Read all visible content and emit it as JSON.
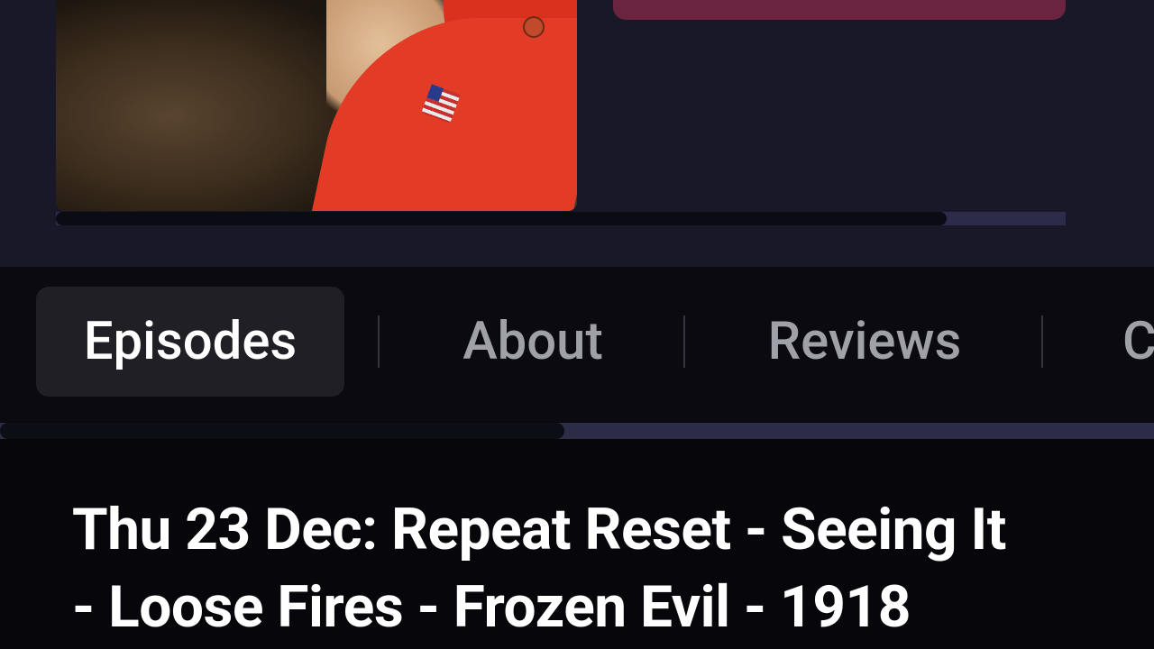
{
  "header": {
    "cover_image": "podcast-cover-image"
  },
  "tabs": [
    {
      "label": "Episodes",
      "active": true
    },
    {
      "label": "About",
      "active": false
    },
    {
      "label": "Reviews",
      "active": false
    },
    {
      "label": "C",
      "active": false
    }
  ],
  "episode": {
    "title_line1": "Thu 23 Dec: Repeat Reset - Seeing It",
    "title_line2": "- Loose Fires - Frozen Evil - 1918"
  },
  "colors": {
    "background": "#07070b",
    "header_background": "#181828",
    "accent_button": "#6b2440",
    "active_tab": "#1f1f25"
  }
}
